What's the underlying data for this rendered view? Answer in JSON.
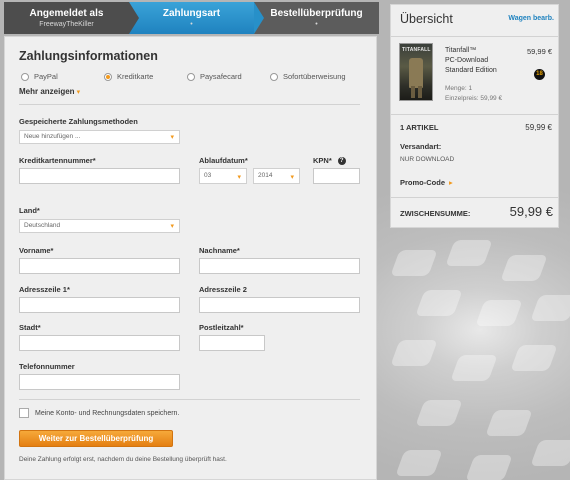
{
  "steps": [
    {
      "title": "Angemeldet als",
      "sub": "FreewayTheKiller"
    },
    {
      "title": "Zahlungsart",
      "sub": "•"
    },
    {
      "title": "Bestellüberprüfung",
      "sub": "•"
    }
  ],
  "payment": {
    "heading": "Zahlungsinformationen",
    "methods": [
      {
        "label": "PayPal",
        "selected": false
      },
      {
        "label": "Kreditkarte",
        "selected": true
      },
      {
        "label": "Paysafecard",
        "selected": false
      },
      {
        "label": "Sofortüberweisung",
        "selected": false
      }
    ],
    "more_label": "Mehr anzeigen",
    "saved_methods_label": "Gespeicherte Zahlungsmethoden",
    "saved_methods_value": "Neue hinzufügen ...",
    "card_number_label": "Kreditkartennummer*",
    "expiry_label": "Ablaufdatum*",
    "expiry_month": "03",
    "expiry_year": "2014",
    "cvc_label": "KPN*",
    "country_label": "Land*",
    "country_value": "Deutschland",
    "first_name_label": "Vorname*",
    "last_name_label": "Nachname*",
    "address1_label": "Adresszeile 1*",
    "address2_label": "Adresszeile 2",
    "city_label": "Stadt*",
    "zip_label": "Postleitzahl*",
    "phone_label": "Telefonnummer",
    "save_data_label": "Meine Konto- und Rechnungsdaten speichern.",
    "continue_button": "Weiter zur Bestellüberprüfung",
    "note": "Deine Zahlung erfolgt erst, nachdem du deine Bestellung überprüft hast."
  },
  "overview": {
    "title": "Übersicht",
    "edit_link": "Wagen bearb.",
    "product": {
      "cover_text": "TITANFALL",
      "name": "Titanfall™",
      "line2": "PC-Download",
      "line3": "Standard Edition",
      "price": "59,99 €",
      "qty": "Menge: 1",
      "unit_price": "Einzelpreis: 59,99 €",
      "rating_badge": "18"
    },
    "items_label": "1 ARTIKEL",
    "items_total": "59,99 €",
    "shipping_label": "Versandart:",
    "shipping_value": "NUR DOWNLOAD",
    "promo_label": "Promo-Code",
    "subtotal_label": "ZWISCHENSUMME:",
    "subtotal_value": "59,99 €"
  },
  "colors": {
    "accent": "#f29a1e",
    "step_active": "#2790c9",
    "link": "#1f82bf"
  }
}
